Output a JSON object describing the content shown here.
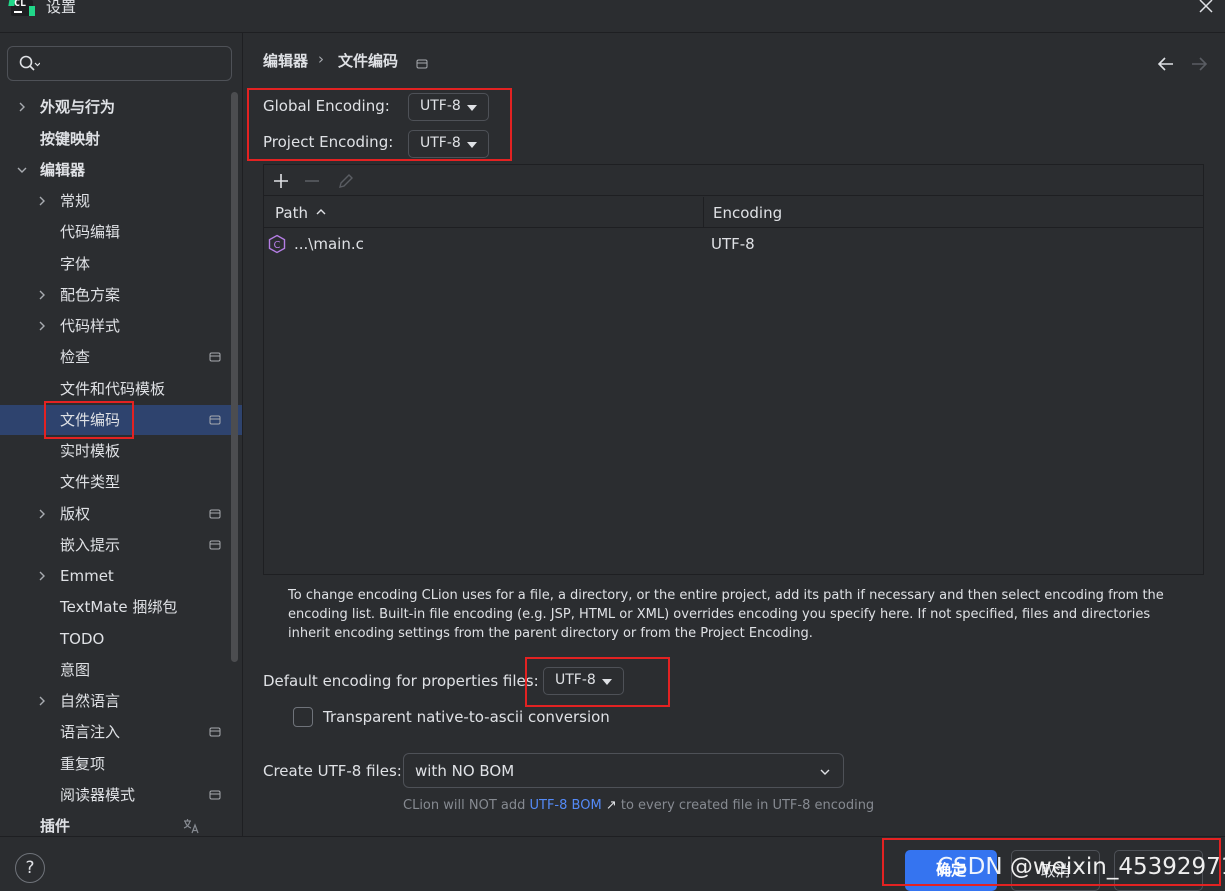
{
  "window": {
    "title": "设置",
    "logo_text": "CL"
  },
  "sidebar": {
    "items": [
      {
        "label": "外观与行为"
      },
      {
        "label": "按键映射"
      },
      {
        "label": "编辑器"
      },
      {
        "label": "常规"
      },
      {
        "label": "代码编辑"
      },
      {
        "label": "字体"
      },
      {
        "label": "配色方案"
      },
      {
        "label": "代码样式"
      },
      {
        "label": "检查"
      },
      {
        "label": "文件和代码模板"
      },
      {
        "label": "文件编码"
      },
      {
        "label": "实时模板"
      },
      {
        "label": "文件类型"
      },
      {
        "label": "版权"
      },
      {
        "label": "嵌入提示"
      },
      {
        "label": "Emmet"
      },
      {
        "label": "TextMate 捆绑包"
      },
      {
        "label": "TODO"
      },
      {
        "label": "意图"
      },
      {
        "label": "自然语言"
      },
      {
        "label": "语言注入"
      },
      {
        "label": "重复项"
      },
      {
        "label": "阅读器模式"
      },
      {
        "label": "插件"
      }
    ]
  },
  "breadcrumb": {
    "parent": "编辑器",
    "separator": "›",
    "current": "文件编码"
  },
  "encoding": {
    "global_label": "Global Encoding:",
    "global_value": "UTF-8",
    "project_label": "Project Encoding:",
    "project_value": "UTF-8"
  },
  "table": {
    "columns": [
      "Path",
      "Encoding"
    ],
    "sort_indicator": "^",
    "rows": [
      {
        "path": "...\\main.c",
        "encoding": "UTF-8",
        "file_icon_letter": "C"
      }
    ]
  },
  "help_text": "To change encoding CLion uses for a file, a directory, or the entire project, add its path if necessary and then select encoding from the encoding list. Built-in file encoding (e.g. JSP, HTML or XML) overrides encoding you specify here. If not specified, files and directories inherit encoding settings from the parent directory or from the Project Encoding.",
  "properties": {
    "label": "Default encoding for properties files:",
    "value": "UTF-8"
  },
  "native_to_ascii": {
    "label": "Transparent native-to-ascii conversion",
    "checked": false
  },
  "bom": {
    "label": "Create UTF-8 files:",
    "value": "with NO BOM",
    "hint_before": "CLion will NOT add",
    "hint_link": "UTF-8 BOM",
    "hint_arrow": "↗",
    "hint_after": "to every created file in UTF-8 encoding"
  },
  "footer": {
    "help": "?",
    "ok": "确定",
    "cancel": "取消",
    "apply": ""
  },
  "watermark": "CSDN @weixin_45392971",
  "colors": {
    "accent": "#3574f0",
    "selection": "#2e436e",
    "highlight_box": "#e32222",
    "c_icon": "#b57ee5"
  }
}
